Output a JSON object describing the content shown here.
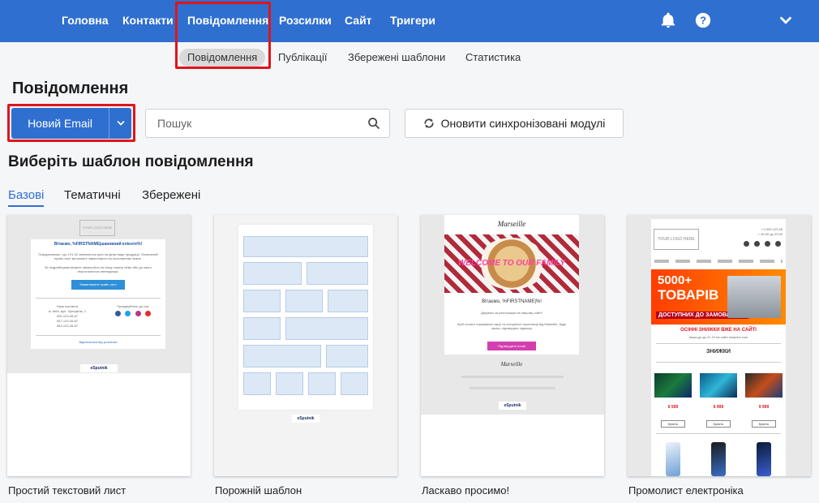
{
  "topnav": {
    "items": [
      "Головна",
      "Контакти",
      "Повідомлення",
      "Розсилки",
      "Сайт",
      "Тригери"
    ],
    "active": "Повідомлення"
  },
  "subnav": {
    "items": [
      "Повідомлення",
      "Публікації",
      "Збережені шаблони",
      "Статистика"
    ],
    "active": "Повідомлення"
  },
  "page_title": "Повідомлення",
  "actions": {
    "new_email": "Новий Email",
    "search_placeholder": "Пошук",
    "sync": "Оновити синхронізовані модулі"
  },
  "section_title": "Виберіть шаблон повідомлення",
  "tabs": [
    "Базові",
    "Тематичні",
    "Збережені"
  ],
  "templates": [
    {
      "name": "Простий текстовий лист",
      "logo": "YOUR LOGO HERE",
      "greeting": "Вітаємо, %FIRSTNAME|шановний клієнте%!",
      "body": "Повідомляємо, що з 01.02 змінюються ціни на деякі види продукції. Оновлений прайс-лист ви можете завантажити за посиланням нижче.",
      "body2": "За подробицями можете звернутися на нашу гарячу лінію або до свого персонального менеджера.",
      "button": "Завантажити прайс-лист",
      "contacts_title": "Наші контакти",
      "address": "м. Київ, вул. Хрещатик, 1",
      "phones": [
        "000-123-45-67",
        "067-123-45-67",
        "063-123-45-67"
      ],
      "social_title": "Приєднуйтесь до нас",
      "unsubscribe": "Відписатися від розсилки",
      "brand": "eSputnik"
    },
    {
      "name": "Порожній шаблон",
      "brand": "eSputnik"
    },
    {
      "name": "Ласкаво просимо!",
      "logo": "Marseille",
      "banner": "WELCOME TO OUR FAMILY",
      "greeting": "Вітаємо, %FIRSTNAME|%!",
      "thanks": "Дякуємо за реєстрацію на нашому сайті!",
      "body": "Щоб почати отримувати акції та спеціальні пропозиції від Marseille, будь ласка, підтвердіть підписку",
      "button": "Підтвердити email",
      "brand": "eSputnik"
    },
    {
      "name": "Промолист електроніка",
      "logo": "YOUR LOGO HERE",
      "phones": [
        "+ 0 000 123 45",
        "+ 00 00 до 23 00"
      ],
      "promo_big": [
        "5000+",
        "ТОВАРІВ"
      ],
      "promo_small": "ДОСТУПНИХ ДО ЗАМОВЛЕННЯ",
      "sale_title": "ОСІННІ ЗНИЖКИ ВЖЕ НА САЙТІ",
      "sale_sub": "Акція до до 21.10 на сайті lowprice.com",
      "section": "ЗНИЖКИ",
      "prices": [
        "6 599",
        "6 999",
        "9 999"
      ],
      "buy": "Купить"
    }
  ],
  "colors": {
    "brand_blue": "#2f6fd0",
    "highlight_red": "#e0141b",
    "active_tab": "#2f6fd0"
  }
}
